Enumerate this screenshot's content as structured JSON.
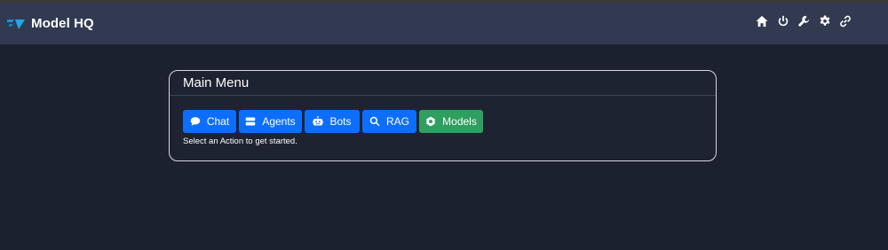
{
  "app": {
    "title": "Model HQ"
  },
  "nav_icons": [
    "home-icon",
    "power-icon",
    "wrench-icon",
    "gear-icon",
    "link-icon"
  ],
  "card": {
    "title": "Main Menu",
    "hint": "Select an Action to get started."
  },
  "actions": [
    {
      "label": "Chat",
      "icon": "chat-icon",
      "color": "#0d6efd"
    },
    {
      "label": "Agents",
      "icon": "server-icon",
      "color": "#0d6efd"
    },
    {
      "label": "Bots",
      "icon": "robot-icon",
      "color": "#0d6efd"
    },
    {
      "label": "RAG",
      "icon": "search-icon",
      "color": "#0d6efd"
    },
    {
      "label": "Models",
      "icon": "cog-icon",
      "color": "#2f9f60"
    }
  ],
  "colors": {
    "navbar": "#313a50",
    "background": "#1c2130",
    "primary": "#0d6efd",
    "success": "#2f9f60"
  }
}
